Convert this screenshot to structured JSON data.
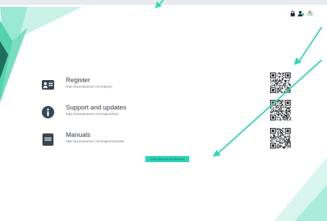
{
  "colors": {
    "accent": "#2ed3b5",
    "annotation": "#2fd8b7",
    "text_primary": "#2f3a44",
    "text_secondary": "#6d7780",
    "icon": "#3a4650"
  },
  "header": {
    "icons": [
      "lock-icon",
      "account-icon",
      "bluetooth-icon"
    ]
  },
  "items": [
    {
      "icon": "id-card-icon",
      "title": "Register",
      "url": "https://expertquantum.com/register/"
    },
    {
      "icon": "info-icon",
      "title": "Support and updates",
      "url": "https://expertquantum.com/support/help/"
    },
    {
      "icon": "manual-icon",
      "title": "Manuals",
      "url": "https://expertquantum.com/support/manuals/"
    }
  ],
  "cta": {
    "label": "CONTINUE REGISTRATION"
  }
}
